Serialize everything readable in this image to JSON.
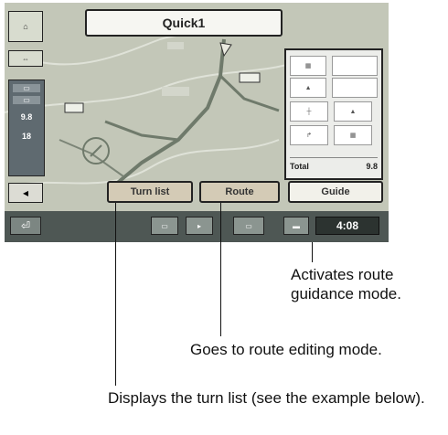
{
  "screen": {
    "title": "Quick1",
    "buttons": {
      "turn_list": "Turn list",
      "route": "Route",
      "guide": "Guide"
    },
    "list_panel": {
      "total_label": "Total",
      "total_value": "9.8"
    },
    "clock": "4:08",
    "left_panel": {
      "distance": "9.8",
      "time": "18"
    }
  },
  "callouts": {
    "guide": "Activates route guidance mode.",
    "route": "Goes to route editing mode.",
    "turn_list": "Displays the turn list (see the example below)."
  },
  "colors": {
    "map_bg": "#c3c7b8",
    "route_line": "#6f7a6b",
    "bar": "#4e5754"
  }
}
